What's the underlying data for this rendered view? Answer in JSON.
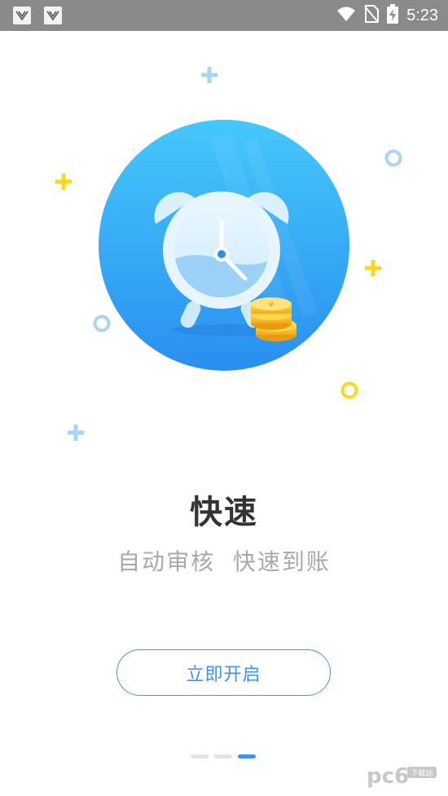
{
  "status_bar": {
    "time": "5:23",
    "icons": [
      "notification-app-icon",
      "notification-app-icon",
      "wifi-icon",
      "no-sim-icon",
      "battery-charging-icon"
    ]
  },
  "onboarding": {
    "illustration": "alarm-clock-with-coins",
    "title": "快速",
    "subtitle": "自动审核  快速到账",
    "start_button_label": "立即开启",
    "page_indicator": {
      "total": 3,
      "active": 3
    }
  },
  "watermark": {
    "text": "pc6",
    "sub_text": "下载站"
  },
  "colors": {
    "accent": "#3d93f3",
    "title": "#333333",
    "subtitle": "#a9a9a9",
    "status_bar": "#8a8a8a",
    "decor_yellow": "#ffd71a",
    "decor_blue": "#a7d4f7"
  }
}
